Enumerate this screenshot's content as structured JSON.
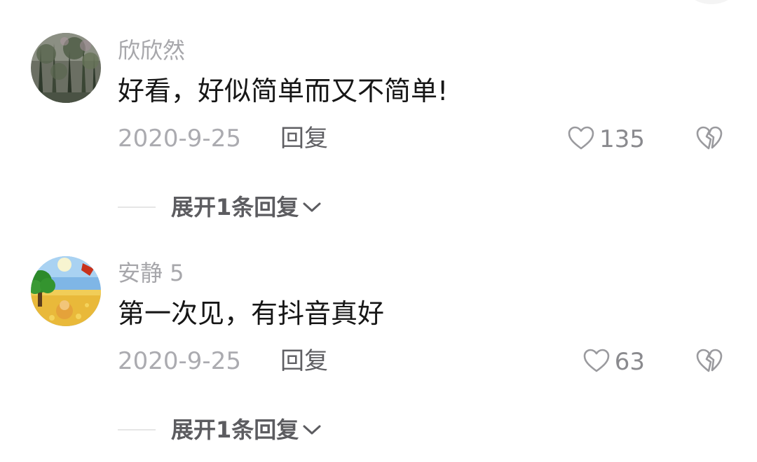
{
  "comments": [
    {
      "username": "欣欣然",
      "text": "好看，好似简单而又不简单!",
      "date": "2020-9-25",
      "reply_label": "回复",
      "likes": "135",
      "expand_label": "展开1条回复"
    },
    {
      "username": "安静 5",
      "text": "第一次见，有抖音真好",
      "date": "2020-9-25",
      "reply_label": "回复",
      "likes": "63",
      "expand_label": "展开1条回复"
    }
  ],
  "icons": {
    "like": "heart-outline-icon",
    "dislike": "broken-heart-icon",
    "expand": "chevron-down-icon"
  },
  "colors": {
    "username": "#a7a7ab",
    "text": "#161616",
    "meta": "#ababb0",
    "icon": "#9a9a9e"
  }
}
